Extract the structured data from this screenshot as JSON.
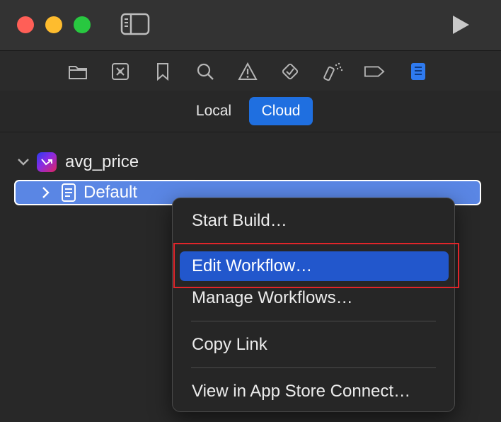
{
  "navigator": {
    "icons": [
      "folder-icon",
      "source-control-icon",
      "bookmark-icon",
      "search-icon",
      "warning-icon",
      "test-icon",
      "debug-icon",
      "breakpoint-icon",
      "report-icon"
    ],
    "selected_icon": "report-icon"
  },
  "tabs": {
    "local": "Local",
    "cloud": "Cloud",
    "selected": "Cloud"
  },
  "tree": {
    "project_label": "avg_price",
    "workflow_label": "Default"
  },
  "context_menu": {
    "items": [
      {
        "label": "Start Build…"
      },
      {
        "label": "Edit Workflow…"
      },
      {
        "label": "Manage Workflows…"
      },
      {
        "label": "Copy Link"
      },
      {
        "label": "View in App Store Connect…"
      }
    ],
    "highlighted": "Edit Workflow…"
  },
  "colors": {
    "accent": "#1f6fe0",
    "menu_selection": "#2257cc",
    "annotation_box": "#e0252a",
    "selected_row": "#5a86e4"
  }
}
